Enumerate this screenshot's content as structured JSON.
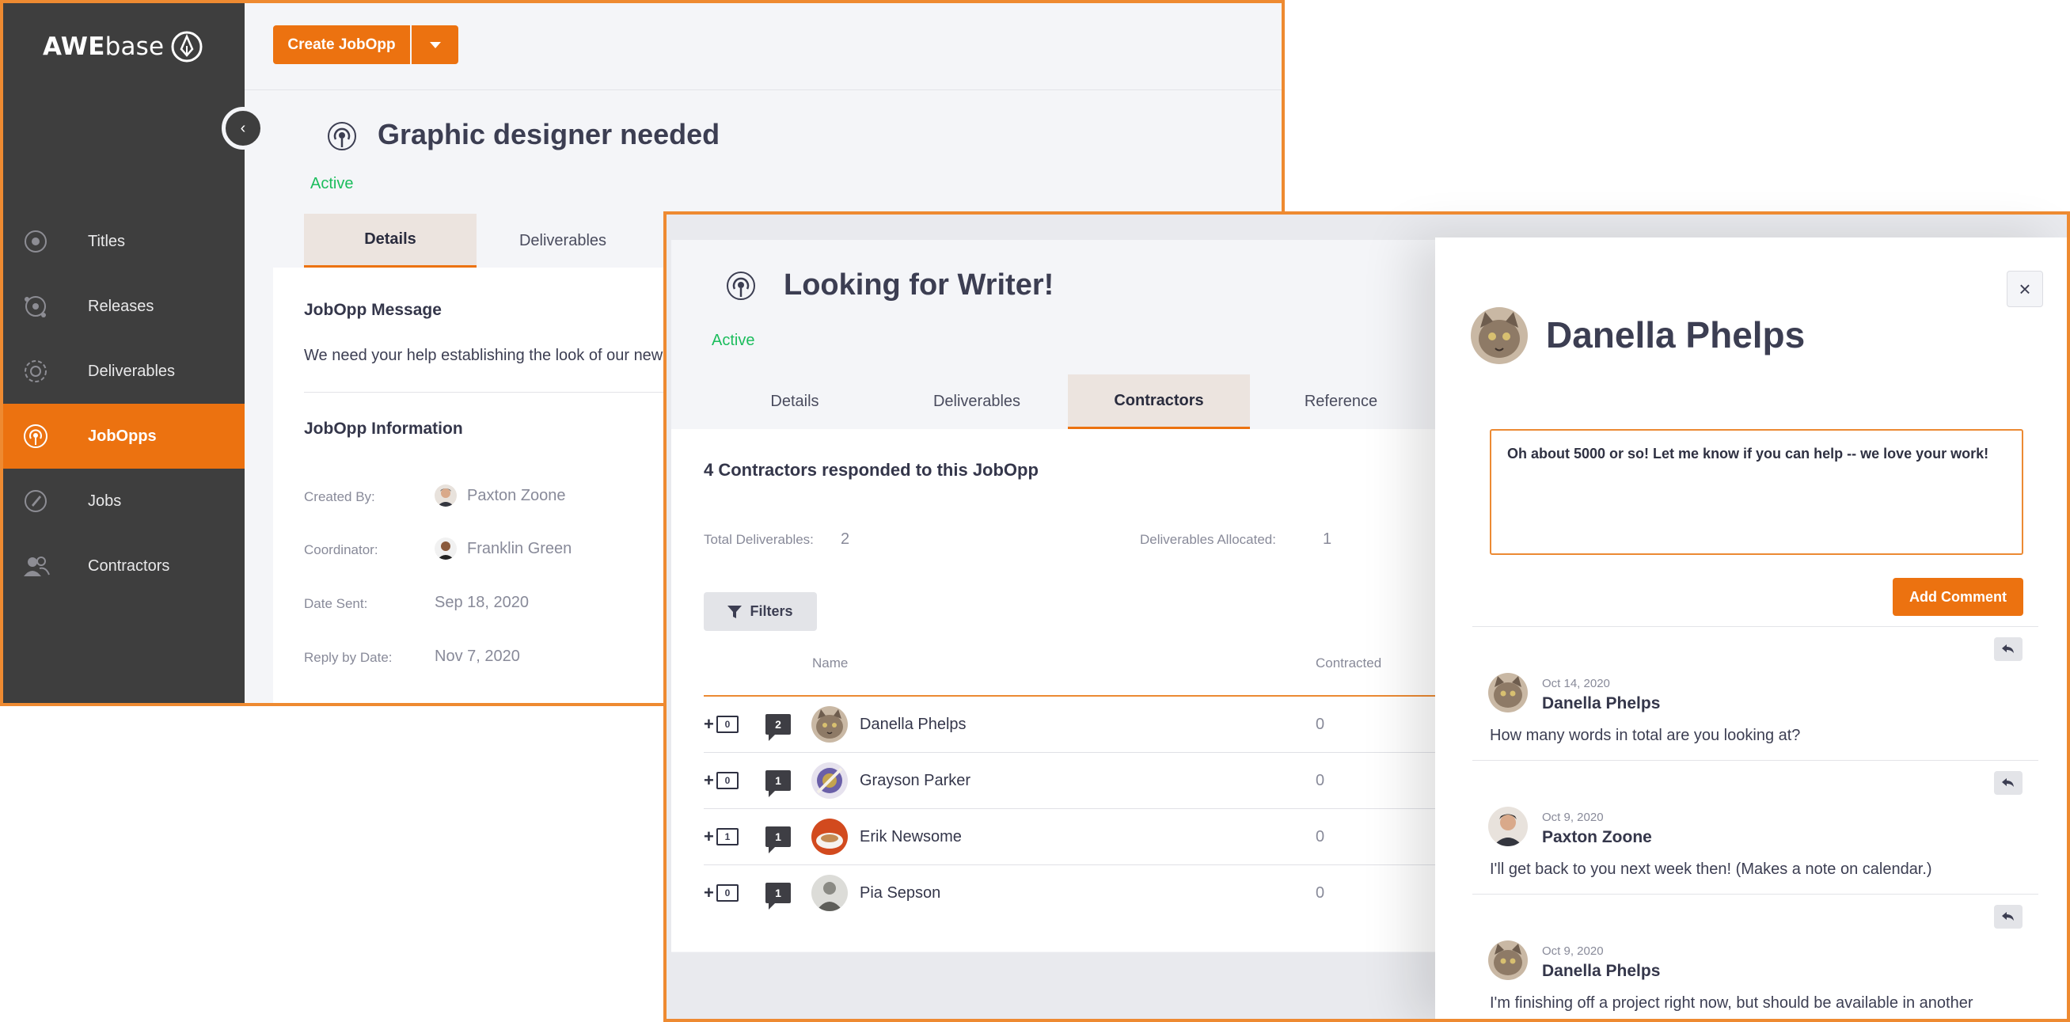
{
  "app": {
    "logo_bold": "AWE",
    "logo_light": "base"
  },
  "sidebar": {
    "items": [
      {
        "label": "Titles",
        "icon": "disc-icon"
      },
      {
        "label": "Releases",
        "icon": "release-icon"
      },
      {
        "label": "Deliverables",
        "icon": "deliverables-icon"
      },
      {
        "label": "JobOpps",
        "icon": "broadcast-icon",
        "active": true
      },
      {
        "label": "Jobs",
        "icon": "rocket-icon"
      },
      {
        "label": "Contractors",
        "icon": "users-icon"
      }
    ]
  },
  "toolbar": {
    "create_label": "Create JobOpp"
  },
  "jobopp1": {
    "title": "Graphic designer needed",
    "status": "Active",
    "tabs": [
      {
        "label": "Details"
      },
      {
        "label": "Deliverables"
      }
    ],
    "message_heading": "JobOpp Message",
    "message_text": "We need your help establishing the look of our new pa",
    "info_heading": "JobOpp Information",
    "info": {
      "created_by_label": "Created By:",
      "created_by": "Paxton Zoone",
      "coordinator_label": "Coordinator:",
      "coordinator": "Franklin Green",
      "date_sent_label": "Date Sent:",
      "date_sent": "Sep 18, 2020",
      "reply_by_label": "Reply by Date:",
      "reply_by": "Nov 7, 2020"
    }
  },
  "jobopp2": {
    "title": "Looking for Writer!",
    "status": "Active",
    "tabs": [
      {
        "label": "Details"
      },
      {
        "label": "Deliverables"
      },
      {
        "label": "Contractors"
      },
      {
        "label": "Reference"
      }
    ],
    "summary": "4 Contractors responded to this JobOpp",
    "total_deliverables_label": "Total Deliverables:",
    "total_deliverables": "2",
    "allocated_label": "Deliverables Allocated:",
    "allocated": "1",
    "filters_label": "Filters",
    "columns": {
      "name": "Name",
      "contracted": "Contracted"
    },
    "rows": [
      {
        "count": "0",
        "messages": "2",
        "name": "Danella Phelps",
        "contracted": "0"
      },
      {
        "count": "0",
        "messages": "1",
        "name": "Grayson Parker",
        "contracted": "0"
      },
      {
        "count": "1",
        "messages": "1",
        "name": "Erik Newsome",
        "contracted": "0"
      },
      {
        "count": "0",
        "messages": "1",
        "name": "Pia Sepson",
        "contracted": "0"
      }
    ]
  },
  "panel": {
    "name": "Danella Phelps",
    "comment_value": "Oh about 5000 or so! Let me know if you can help -- we love your work!",
    "add_comment_label": "Add Comment",
    "comments": [
      {
        "date": "Oct 14, 2020",
        "name": "Danella Phelps",
        "text": "How many words in total are you looking at?"
      },
      {
        "date": "Oct 9, 2020",
        "name": "Paxton Zoone",
        "text": "I'll get back to you next week then! (Makes a note on calendar.)"
      },
      {
        "date": "Oct 9, 2020",
        "name": "Danella Phelps",
        "text": "I'm finishing off a project right now, but should be available in another"
      }
    ]
  },
  "colors": {
    "accent": "#ec7210",
    "sidebar": "#3e3e3e",
    "active_green": "#1cbd5d",
    "frame": "#ee8a31"
  }
}
